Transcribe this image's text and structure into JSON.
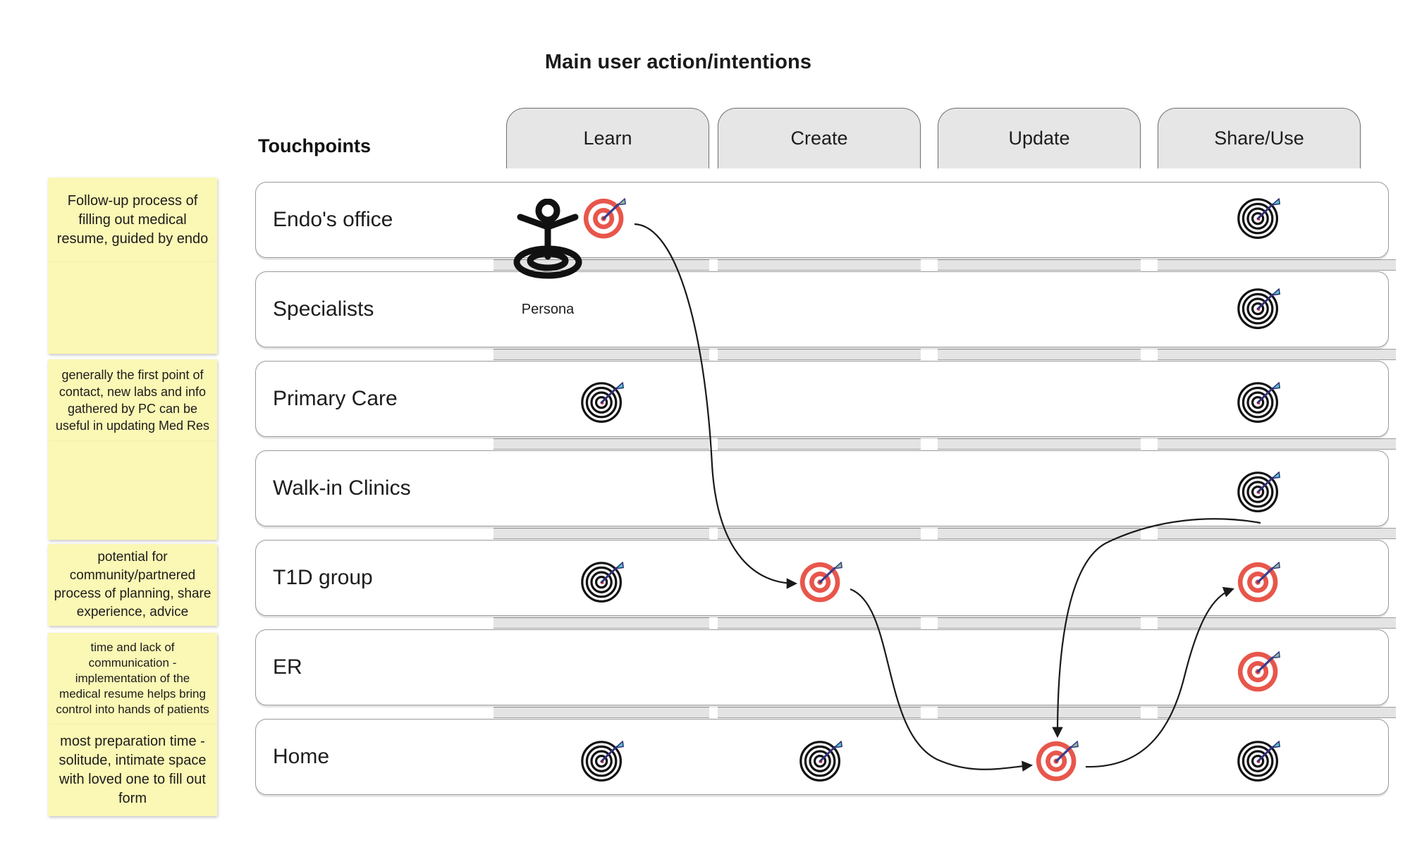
{
  "header": {
    "title": "Main user action/intentions",
    "touchpoints_label": "Touchpoints"
  },
  "columns": [
    {
      "id": "learn",
      "label": "Learn"
    },
    {
      "id": "create",
      "label": "Create"
    },
    {
      "id": "update",
      "label": "Update"
    },
    {
      "id": "share-use",
      "label": "Share/Use"
    }
  ],
  "rows": [
    {
      "id": "endos-office",
      "label": "Endo's office"
    },
    {
      "id": "specialists",
      "label": "Specialists"
    },
    {
      "id": "primary-care",
      "label": "Primary Care"
    },
    {
      "id": "walkin-clinics",
      "label": "Walk-in Clinics"
    },
    {
      "id": "t1d-group",
      "label": "T1D group"
    },
    {
      "id": "er",
      "label": "ER"
    },
    {
      "id": "home",
      "label": "Home"
    }
  ],
  "persona": {
    "label": "Persona",
    "icon": "persona-standing-icon"
  },
  "markers": [
    {
      "row": "endos-office",
      "column": "learn",
      "style": "highlighted",
      "icon": "target-arrow-icon"
    },
    {
      "row": "endos-office",
      "column": "share-use",
      "style": "plain",
      "icon": "target-arrow-icon"
    },
    {
      "row": "specialists",
      "column": "share-use",
      "style": "plain",
      "icon": "target-arrow-icon"
    },
    {
      "row": "primary-care",
      "column": "learn",
      "style": "plain",
      "icon": "target-arrow-icon"
    },
    {
      "row": "primary-care",
      "column": "share-use",
      "style": "plain",
      "icon": "target-arrow-icon"
    },
    {
      "row": "walkin-clinics",
      "column": "share-use",
      "style": "plain",
      "icon": "target-arrow-icon"
    },
    {
      "row": "t1d-group",
      "column": "learn",
      "style": "plain",
      "icon": "target-arrow-icon"
    },
    {
      "row": "t1d-group",
      "column": "create",
      "style": "highlighted",
      "icon": "target-arrow-icon"
    },
    {
      "row": "t1d-group",
      "column": "share-use",
      "style": "highlighted",
      "icon": "target-arrow-icon"
    },
    {
      "row": "er",
      "column": "share-use",
      "style": "highlighted",
      "icon": "target-arrow-icon"
    },
    {
      "row": "home",
      "column": "learn",
      "style": "plain",
      "icon": "target-arrow-icon"
    },
    {
      "row": "home",
      "column": "create",
      "style": "plain",
      "icon": "target-arrow-icon"
    },
    {
      "row": "home",
      "column": "update",
      "style": "highlighted",
      "icon": "target-arrow-icon"
    },
    {
      "row": "home",
      "column": "share-use",
      "style": "plain",
      "icon": "target-arrow-icon"
    }
  ],
  "flow": [
    {
      "from": {
        "row": "endos-office",
        "column": "learn"
      },
      "to": {
        "row": "t1d-group",
        "column": "create"
      }
    },
    {
      "from": {
        "row": "t1d-group",
        "column": "create"
      },
      "to": {
        "row": "home",
        "column": "update"
      }
    },
    {
      "from": {
        "row": "home",
        "column": "update"
      },
      "to": {
        "row": "t1d-group",
        "column": "share-use"
      }
    },
    {
      "from": {
        "row": "walkin-clinics",
        "column": "share-use"
      },
      "to": {
        "row": "home",
        "column": "update"
      }
    }
  ],
  "notes": [
    {
      "id": "note-endo-followup",
      "text": "Follow-up process of filling out medical resume, guided by endo"
    },
    {
      "id": "note-primary-care",
      "text": "generally the first point of contact, new labs and info gathered by PC can be useful in updating Med Res"
    },
    {
      "id": "note-t1d-group",
      "text": "potential for community/partnered process of planning, share experience, advice"
    },
    {
      "id": "note-er",
      "text": "time and lack of communication - implementation of the medical resume helps bring control into hands of patients"
    },
    {
      "id": "note-home",
      "text": "most preparation time - solitude, intimate space with loved one to fill out form"
    }
  ],
  "colors": {
    "sticky": "#FBF7B5",
    "header_tab": "#E6E6E6",
    "lane_border": "#9A9A9A",
    "target_red": "#E8564B",
    "target_dark": "#111111",
    "arrow_shaft": "#3C3C8C",
    "fletch_green": "#8FBF8F",
    "fletch_teal": "#4FC3C7"
  }
}
